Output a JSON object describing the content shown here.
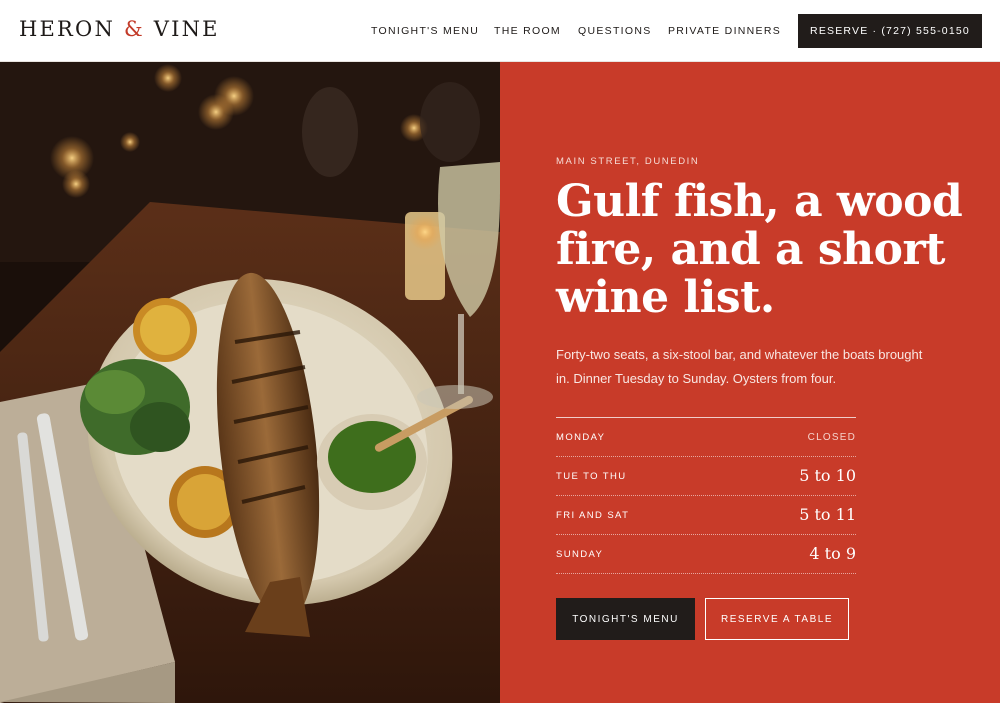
{
  "brand": {
    "name_part1": "HERON",
    "ampersand": "&",
    "name_part2": "VINE"
  },
  "nav": {
    "items": [
      "TONIGHT'S MENU",
      "THE ROOM",
      "QUESTIONS",
      "PRIVATE DINNERS"
    ],
    "reserve_label": "RESERVE · (727) 555-0150"
  },
  "hero": {
    "image_subject": "grilled whole fish on platter with lemons, herbs, green sauce, white wine and candles on wooden table",
    "eyebrow": "MAIN STREET, DUNEDIN",
    "headline": "Gulf fish, a wood fire, and a short wine list.",
    "lede": "Forty-two seats, a six-stool bar, and whatever the boats brought in. Dinner Tuesday to Sunday. Oysters from four.",
    "hours": [
      {
        "day": "MONDAY",
        "time": "CLOSED"
      },
      {
        "day": "TUE TO THU",
        "time": "5 to 10"
      },
      {
        "day": "FRI AND SAT",
        "time": "5 to 11"
      },
      {
        "day": "SUNDAY",
        "time": "4 to 9"
      }
    ],
    "primary_cta": "TONIGHT'S MENU",
    "secondary_cta": "RESERVE A TABLE"
  },
  "colors": {
    "accent_red": "#c83b29",
    "ink": "#211c1a",
    "white": "#ffffff"
  }
}
